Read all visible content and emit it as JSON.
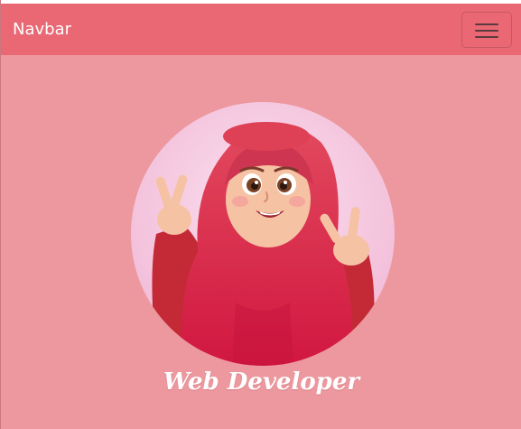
{
  "navbar": {
    "brand": "Navbar",
    "toggle_icon": "hamburger-menu-icon"
  },
  "hero": {
    "avatar_icon": "hijab-girl-peace-sign-avatar",
    "caption": "Web Developer"
  },
  "colors": {
    "page_background": "#ec989e",
    "navbar_background": "#e96874",
    "avatar_circle": "#f3c6e0",
    "hijab": "#d92d4a",
    "caption_text": "#ffffff"
  }
}
